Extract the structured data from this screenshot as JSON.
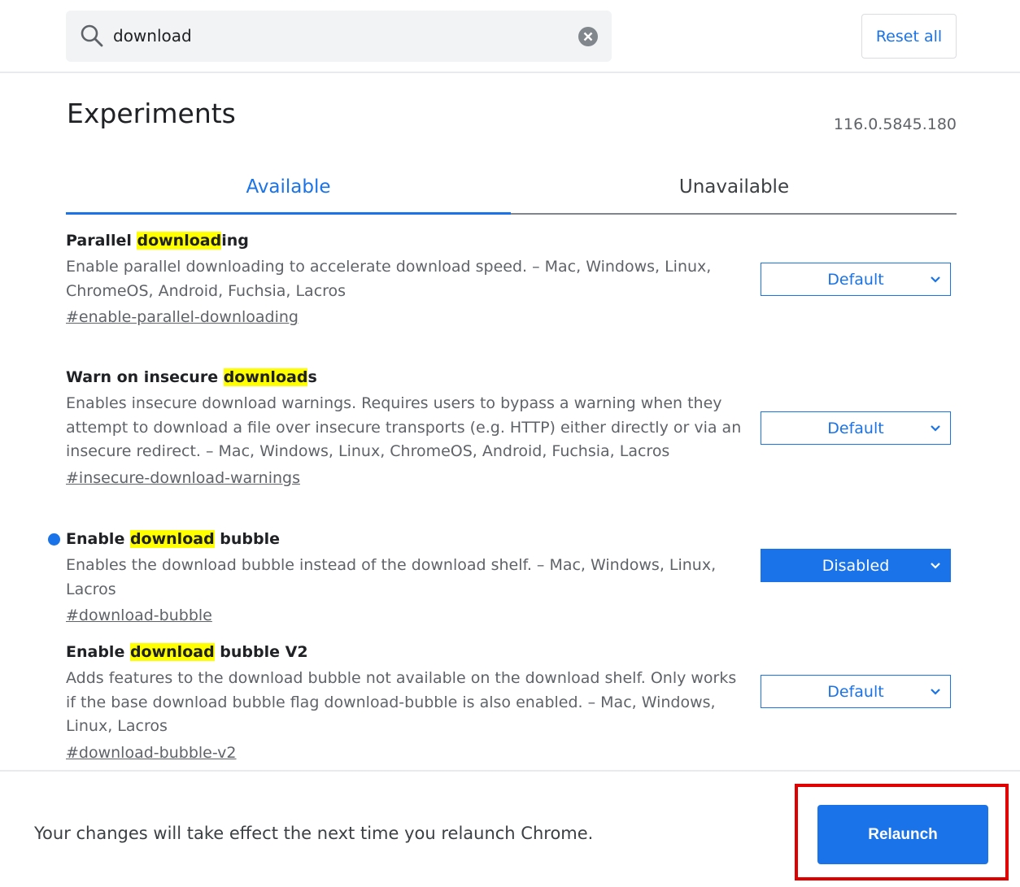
{
  "search": {
    "value": "download"
  },
  "header": {
    "reset_label": "Reset all"
  },
  "page": {
    "title": "Experiments",
    "version": "116.0.5845.180"
  },
  "tabs": [
    {
      "label": "Available",
      "active": true
    },
    {
      "label": "Unavailable",
      "active": false
    }
  ],
  "experiments": [
    {
      "title_before": "Parallel ",
      "title_highlight": "download",
      "title_after": "ing",
      "description": "Enable parallel downloading to accelerate download speed. – Mac, Windows, Linux, ChromeOS, Android, Fuchsia, Lacros",
      "link": "#enable-parallel-downloading",
      "value": "Default",
      "modified": false
    },
    {
      "title_before": "Warn on insecure ",
      "title_highlight": "download",
      "title_after": "s",
      "description": "Enables insecure download warnings. Requires users to bypass a warning when they attempt to download a file over insecure transports (e.g. HTTP) either directly or via an insecure redirect. – Mac, Windows, Linux, ChromeOS, Android, Fuchsia, Lacros",
      "link": "#insecure-download-warnings",
      "value": "Default",
      "modified": false
    },
    {
      "title_before": "Enable ",
      "title_highlight": "download",
      "title_after": " bubble",
      "description": "Enables the download bubble instead of the download shelf. – Mac, Windows, Linux, Lacros",
      "link": "#download-bubble",
      "value": "Disabled",
      "modified": true
    },
    {
      "title_before": "Enable ",
      "title_highlight": "download",
      "title_after": " bubble V2",
      "description": "Adds features to the download bubble not available on the download shelf. Only works if the base download bubble flag download-bubble is also enabled. – Mac, Windows, Linux, Lacros",
      "link": "#download-bubble-v2",
      "value": "Default",
      "modified": false
    }
  ],
  "footer": {
    "message": "Your changes will take effect the next time you relaunch Chrome.",
    "relaunch_label": "Relaunch"
  },
  "colors": {
    "accent": "#1a73e8",
    "highlight": "#ffff00",
    "callout": "#e00000"
  }
}
